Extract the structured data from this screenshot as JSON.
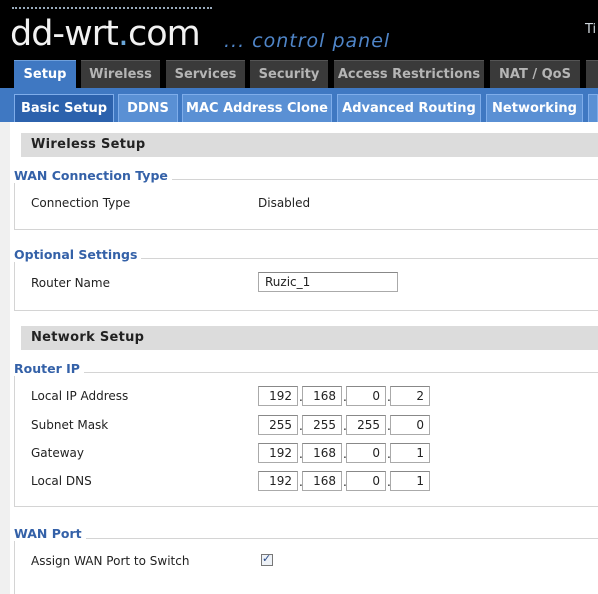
{
  "header": {
    "logo_main": "dd-wrt",
    "logo_dot": ".",
    "logo_tld": "com",
    "subtitle": "... control panel",
    "right_text": "Ti"
  },
  "main_tabs": [
    {
      "label": "Setup",
      "active": true
    },
    {
      "label": "Wireless"
    },
    {
      "label": "Services"
    },
    {
      "label": "Security"
    },
    {
      "label": "Access Restrictions"
    },
    {
      "label": "NAT / QoS"
    }
  ],
  "sub_tabs": [
    {
      "label": "Basic Setup",
      "active": true
    },
    {
      "label": "DDNS"
    },
    {
      "label": "MAC Address Clone"
    },
    {
      "label": "Advanced Routing"
    },
    {
      "label": "Networking"
    }
  ],
  "wireless_setup": {
    "title": "Wireless Setup",
    "wan_connection": {
      "legend": "WAN Connection Type",
      "label": "Connection Type",
      "value": "Disabled"
    },
    "optional": {
      "legend": "Optional Settings",
      "router_name_label": "Router Name",
      "router_name_value": "Ruzic_1"
    }
  },
  "network_setup": {
    "title": "Network Setup",
    "router_ip": {
      "legend": "Router IP",
      "separator": ".",
      "rows": [
        {
          "label": "Local IP Address",
          "octets": [
            "192",
            "168",
            "0",
            "2"
          ]
        },
        {
          "label": "Subnet Mask",
          "octets": [
            "255",
            "255",
            "255",
            "0"
          ]
        },
        {
          "label": "Gateway",
          "octets": [
            "192",
            "168",
            "0",
            "1"
          ]
        },
        {
          "label": "Local DNS",
          "octets": [
            "192",
            "168",
            "0",
            "1"
          ]
        }
      ]
    },
    "wan_port": {
      "legend": "WAN Port",
      "label": "Assign WAN Port to Switch",
      "checked": true,
      "check_glyph": "✓"
    }
  }
}
